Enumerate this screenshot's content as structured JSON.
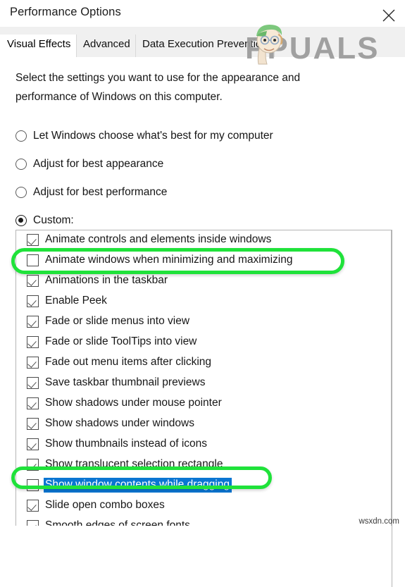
{
  "window": {
    "title": "Performance Options",
    "close_icon": "close-icon"
  },
  "tabs": [
    {
      "label": "Visual Effects",
      "active": true
    },
    {
      "label": "Advanced",
      "active": false
    },
    {
      "label": "Data Execution Prevention",
      "active": false
    }
  ],
  "main": {
    "description": "Select the settings you want to use for the appearance and performance of Windows on this computer.",
    "radio_options": [
      {
        "label": "Let Windows choose what's best for my computer",
        "checked": false
      },
      {
        "label": "Adjust for best appearance",
        "checked": false
      },
      {
        "label": "Adjust for best performance",
        "checked": false
      },
      {
        "label": "Custom:",
        "checked": true
      }
    ],
    "effects_list": [
      {
        "label": "Animate controls and elements inside windows",
        "checked": true,
        "selected": false,
        "annotated": false
      },
      {
        "label": "Animate windows when minimizing and maximizing",
        "checked": false,
        "selected": false,
        "annotated": true
      },
      {
        "label": "Animations in the taskbar",
        "checked": true,
        "selected": false,
        "annotated": false
      },
      {
        "label": "Enable Peek",
        "checked": true,
        "selected": false,
        "annotated": false
      },
      {
        "label": "Fade or slide menus into view",
        "checked": true,
        "selected": false,
        "annotated": false
      },
      {
        "label": "Fade or slide ToolTips into view",
        "checked": true,
        "selected": false,
        "annotated": false
      },
      {
        "label": "Fade out menu items after clicking",
        "checked": true,
        "selected": false,
        "annotated": false
      },
      {
        "label": "Save taskbar thumbnail previews",
        "checked": true,
        "selected": false,
        "annotated": false
      },
      {
        "label": "Show shadows under mouse pointer",
        "checked": true,
        "selected": false,
        "annotated": false
      },
      {
        "label": "Show shadows under windows",
        "checked": true,
        "selected": false,
        "annotated": false
      },
      {
        "label": "Show thumbnails instead of icons",
        "checked": true,
        "selected": false,
        "annotated": false
      },
      {
        "label": "Show translucent selection rectangle",
        "checked": true,
        "selected": false,
        "annotated": false
      },
      {
        "label": "Show window contents while dragging",
        "checked": false,
        "selected": true,
        "annotated": true
      },
      {
        "label": "Slide open combo boxes",
        "checked": true,
        "selected": false,
        "annotated": false
      },
      {
        "label": "Smooth edges of screen fonts",
        "checked": true,
        "selected": false,
        "annotated": false
      }
    ]
  },
  "watermarks": {
    "brand_text": "PPUALS",
    "corner_text": "wsxdn.com"
  },
  "colors": {
    "selection_blue": "#0a76d2",
    "annotation_green": "#1fe23a",
    "tab_strip": "#f0f0f0",
    "listbox_border": "#b5b5b5"
  }
}
